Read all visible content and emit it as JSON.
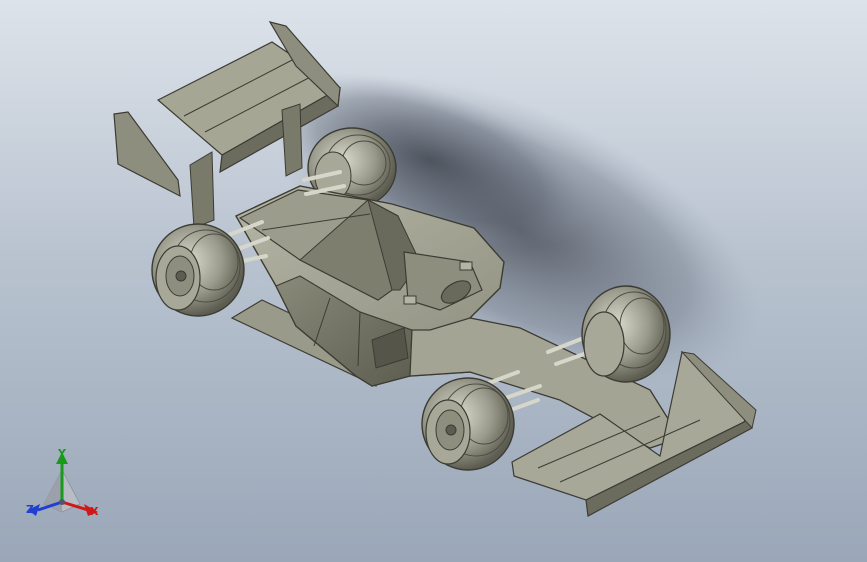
{
  "viewport": {
    "background_top": "#dde3ea",
    "background_bottom": "#9aa7b8",
    "model_color": "#8f8f7f"
  },
  "model": {
    "icon": "race-car-model"
  },
  "triad": {
    "x_label": "X",
    "y_label": "Y",
    "z_label": "Z",
    "x_color": "#d01818",
    "y_color": "#1a9a1a",
    "z_color": "#1e3fd0"
  }
}
